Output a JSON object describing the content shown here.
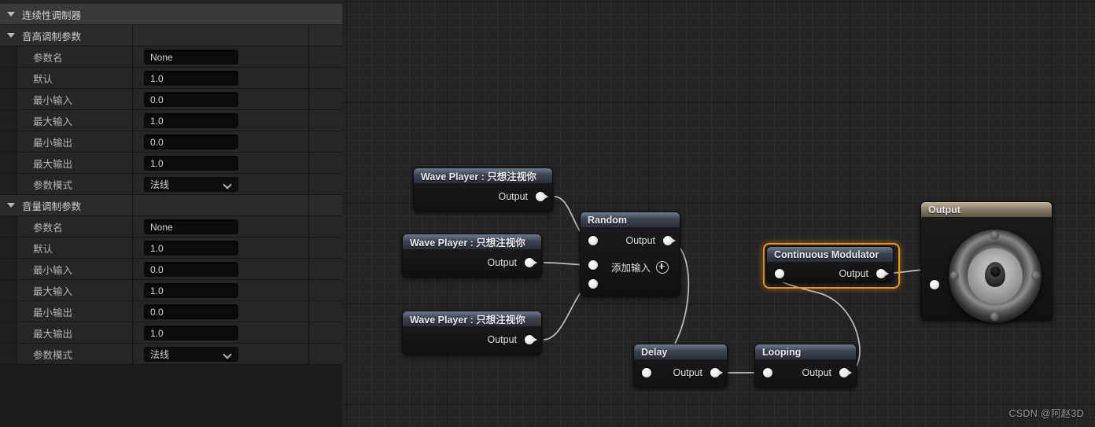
{
  "details_panel": {
    "category": {
      "label": "连续性调制器",
      "expanded": true
    },
    "groups": [
      {
        "label": "音高调制参数",
        "expanded": true,
        "rows": [
          {
            "label": "参数名",
            "value": "None",
            "type": "text"
          },
          {
            "label": "默认",
            "value": "1.0",
            "type": "text"
          },
          {
            "label": "最小输入",
            "value": "0.0",
            "type": "text"
          },
          {
            "label": "最大输入",
            "value": "1.0",
            "type": "text"
          },
          {
            "label": "最小输出",
            "value": "0.0",
            "type": "text"
          },
          {
            "label": "最大输出",
            "value": "1.0",
            "type": "text"
          },
          {
            "label": "参数模式",
            "value": "法线",
            "type": "combo"
          }
        ]
      },
      {
        "label": "音量调制参数",
        "expanded": true,
        "rows": [
          {
            "label": "参数名",
            "value": "None",
            "type": "text"
          },
          {
            "label": "默认",
            "value": "1.0",
            "type": "text"
          },
          {
            "label": "最小输入",
            "value": "0.0",
            "type": "text"
          },
          {
            "label": "最大输入",
            "value": "1.0",
            "type": "text"
          },
          {
            "label": "最小输出",
            "value": "0.0",
            "type": "text"
          },
          {
            "label": "最大输出",
            "value": "1.0",
            "type": "text"
          },
          {
            "label": "参数模式",
            "value": "法线",
            "type": "combo"
          }
        ]
      }
    ]
  },
  "graph": {
    "nodes": {
      "wave1": {
        "title": "Wave Player : 只想注视你",
        "output_label": "Output"
      },
      "wave2": {
        "title": "Wave Player : 只想注视你",
        "output_label": "Output"
      },
      "wave3": {
        "title": "Wave Player : 只想注视你",
        "output_label": "Output"
      },
      "random": {
        "title": "Random",
        "output_label": "Output",
        "add_input_label": "添加输入",
        "input_count": 3
      },
      "delay": {
        "title": "Delay",
        "output_label": "Output"
      },
      "looping": {
        "title": "Looping",
        "output_label": "Output"
      },
      "modulator": {
        "title": "Continuous Modulator",
        "output_label": "Output",
        "selected": true
      },
      "output": {
        "title": "Output"
      }
    },
    "selection_color": "#f0991a",
    "wire_color": "#d4d4d4"
  },
  "watermark": "CSDN @阿赵3D"
}
